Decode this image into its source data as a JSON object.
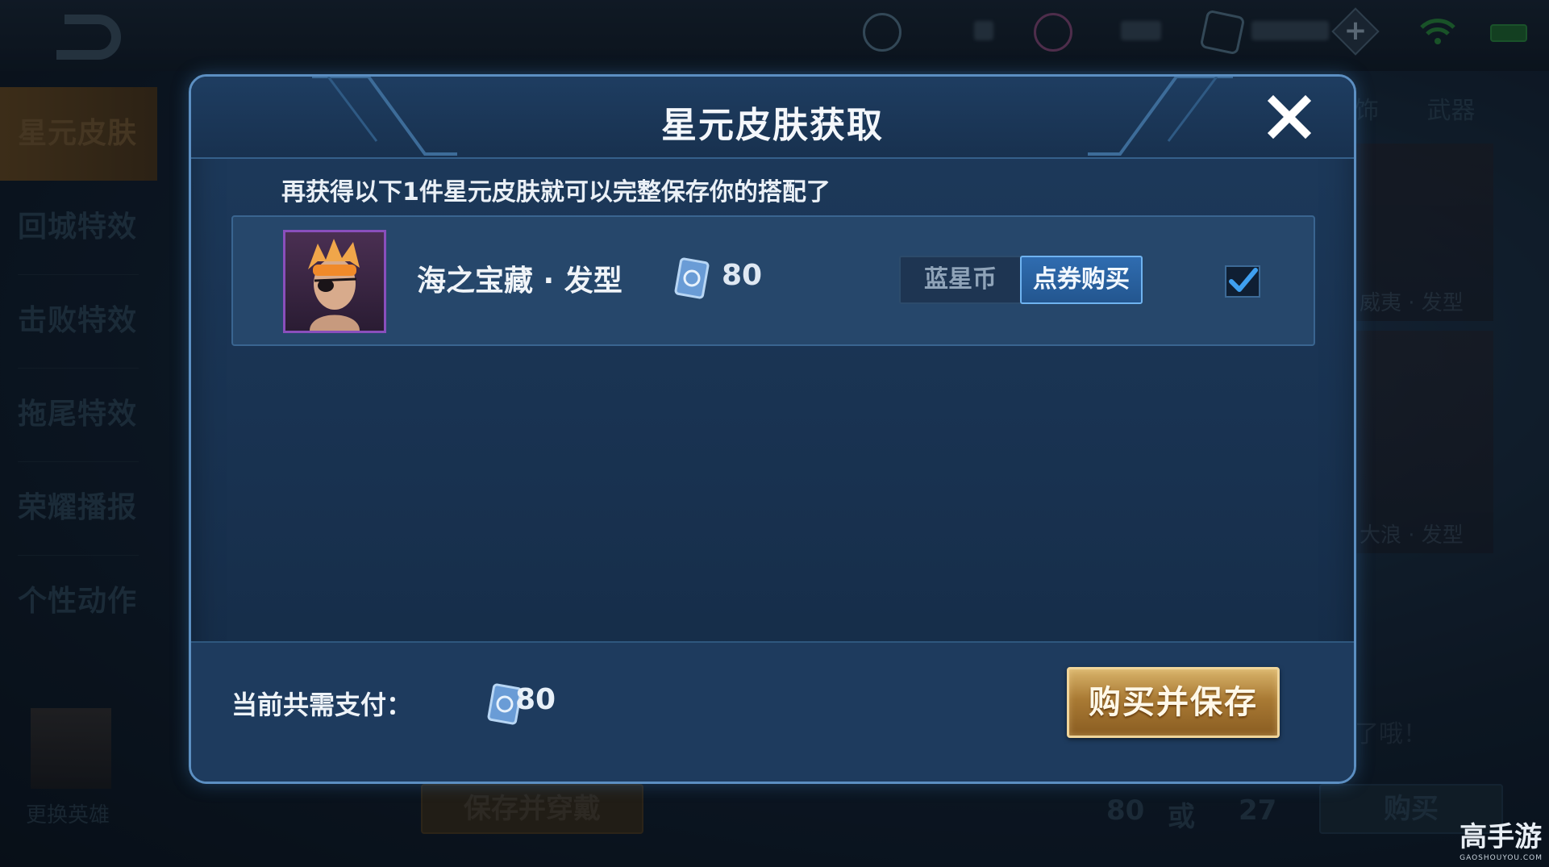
{
  "background": {
    "sidebar": {
      "items": [
        {
          "label": "星元皮肤",
          "active": true
        },
        {
          "label": "回城特效",
          "active": false
        },
        {
          "label": "击败特效",
          "active": false
        },
        {
          "label": "拖尾特效",
          "active": false
        },
        {
          "label": "荣耀播报",
          "active": false
        },
        {
          "label": "个性动作",
          "active": false
        }
      ],
      "change_hero_label": "更换英雄"
    },
    "right_tabs": [
      "饰",
      "武器"
    ],
    "right_cards": [
      "威夷 · 发型",
      "大浪 · 发型"
    ],
    "hint_text": "了哦！",
    "save_wear_label": "保存并穿戴",
    "price_coupon": "80",
    "price_or": "或",
    "price_alt": "27",
    "buy_label": "购买"
  },
  "modal": {
    "title": "星元皮肤获取",
    "subtitle": "再获得以下1件星元皮肤就可以完整保存你的搭配了",
    "item": {
      "name": "海之宝藏 · 发型",
      "price": "80",
      "currency_icon": "coupon-icon",
      "pay_options": [
        "蓝星币",
        "点券购买"
      ],
      "selected_pay_option": "点券购买",
      "checked": true
    },
    "footer": {
      "total_label": "当前共需支付：",
      "total_value": "80",
      "buy_save_label": "购买并保存"
    }
  },
  "watermark": {
    "logo_text": "高手游",
    "domain": "GAOSHOUYOU.COM"
  },
  "colors": {
    "modal_border": "#5c8fc2",
    "accent_blue": "#2f6cb0",
    "gold_button": "#a97a34",
    "check_blue": "#3fa0f0"
  }
}
